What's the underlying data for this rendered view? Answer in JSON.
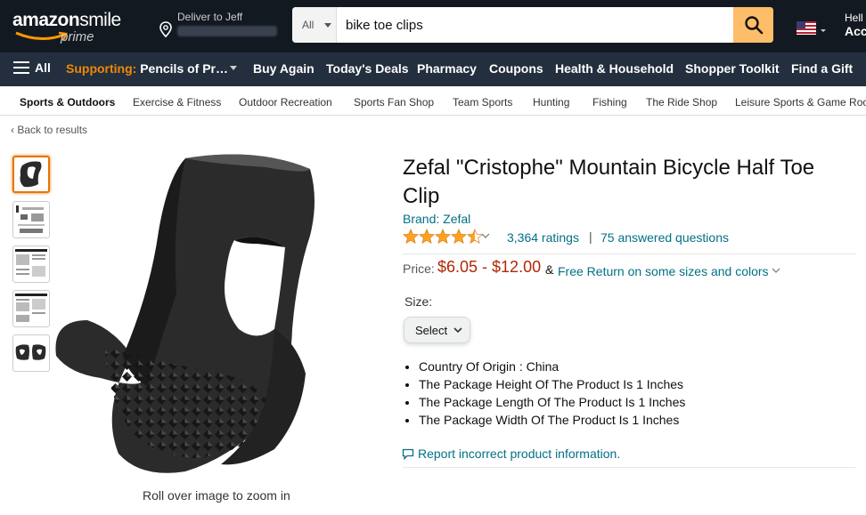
{
  "header": {
    "logo_text": "amazon",
    "logo_smile": "smile",
    "logo_prime": "prime",
    "deliver_label": "Deliver to Jeff",
    "search_category": "All",
    "search_value": "bike toe clips",
    "hello": "Hell",
    "account": "Acc"
  },
  "nav": {
    "all_label": "All",
    "supporting_prefix": "Supporting:",
    "supporting_org": "Pencils of Pr…",
    "items": [
      "Buy Again",
      "Today's Deals",
      "Pharmacy",
      "Coupons",
      "Health & Household",
      "Shopper Toolkit",
      "Find a Gift"
    ]
  },
  "subnav": {
    "items": [
      "Sports & Outdoors",
      "Exercise & Fitness",
      "Outdoor Recreation",
      "Sports Fan Shop",
      "Team Sports",
      "Hunting",
      "Fishing",
      "The Ride Shop",
      "Leisure Sports & Game Roo"
    ]
  },
  "gallery": {
    "back_label": "‹ Back to results",
    "zoom_hint": "Roll over image to zoom in"
  },
  "product": {
    "title": "Zefal \"Cristophe\" Mountain Bicycle Half Toe Clip",
    "brand": "Brand: Zefal",
    "rating_stars": 4.5,
    "ratings_count": "3,364 ratings",
    "separator": "|",
    "answered": "75 answered questions",
    "price_label": "Price:",
    "price_range": "$6.05 - $12.00",
    "price_amp": "&",
    "free_return": "Free Return on some sizes and colors",
    "size_label": "Size:",
    "size_selected": "Select",
    "bullets": [
      "Country Of Origin : China",
      "The Package Height Of The Product Is 1 Inches",
      "The Package Length Of The Product Is 1 Inches",
      "The Package Width Of The Product Is 1 Inches"
    ],
    "report": "Report incorrect product information."
  },
  "colors": {
    "header_bg": "#131921",
    "nav_bg": "#232f3e",
    "search_button": "#febd69",
    "link": "#007185",
    "price": "#b12704",
    "star": "#ffa41c"
  }
}
